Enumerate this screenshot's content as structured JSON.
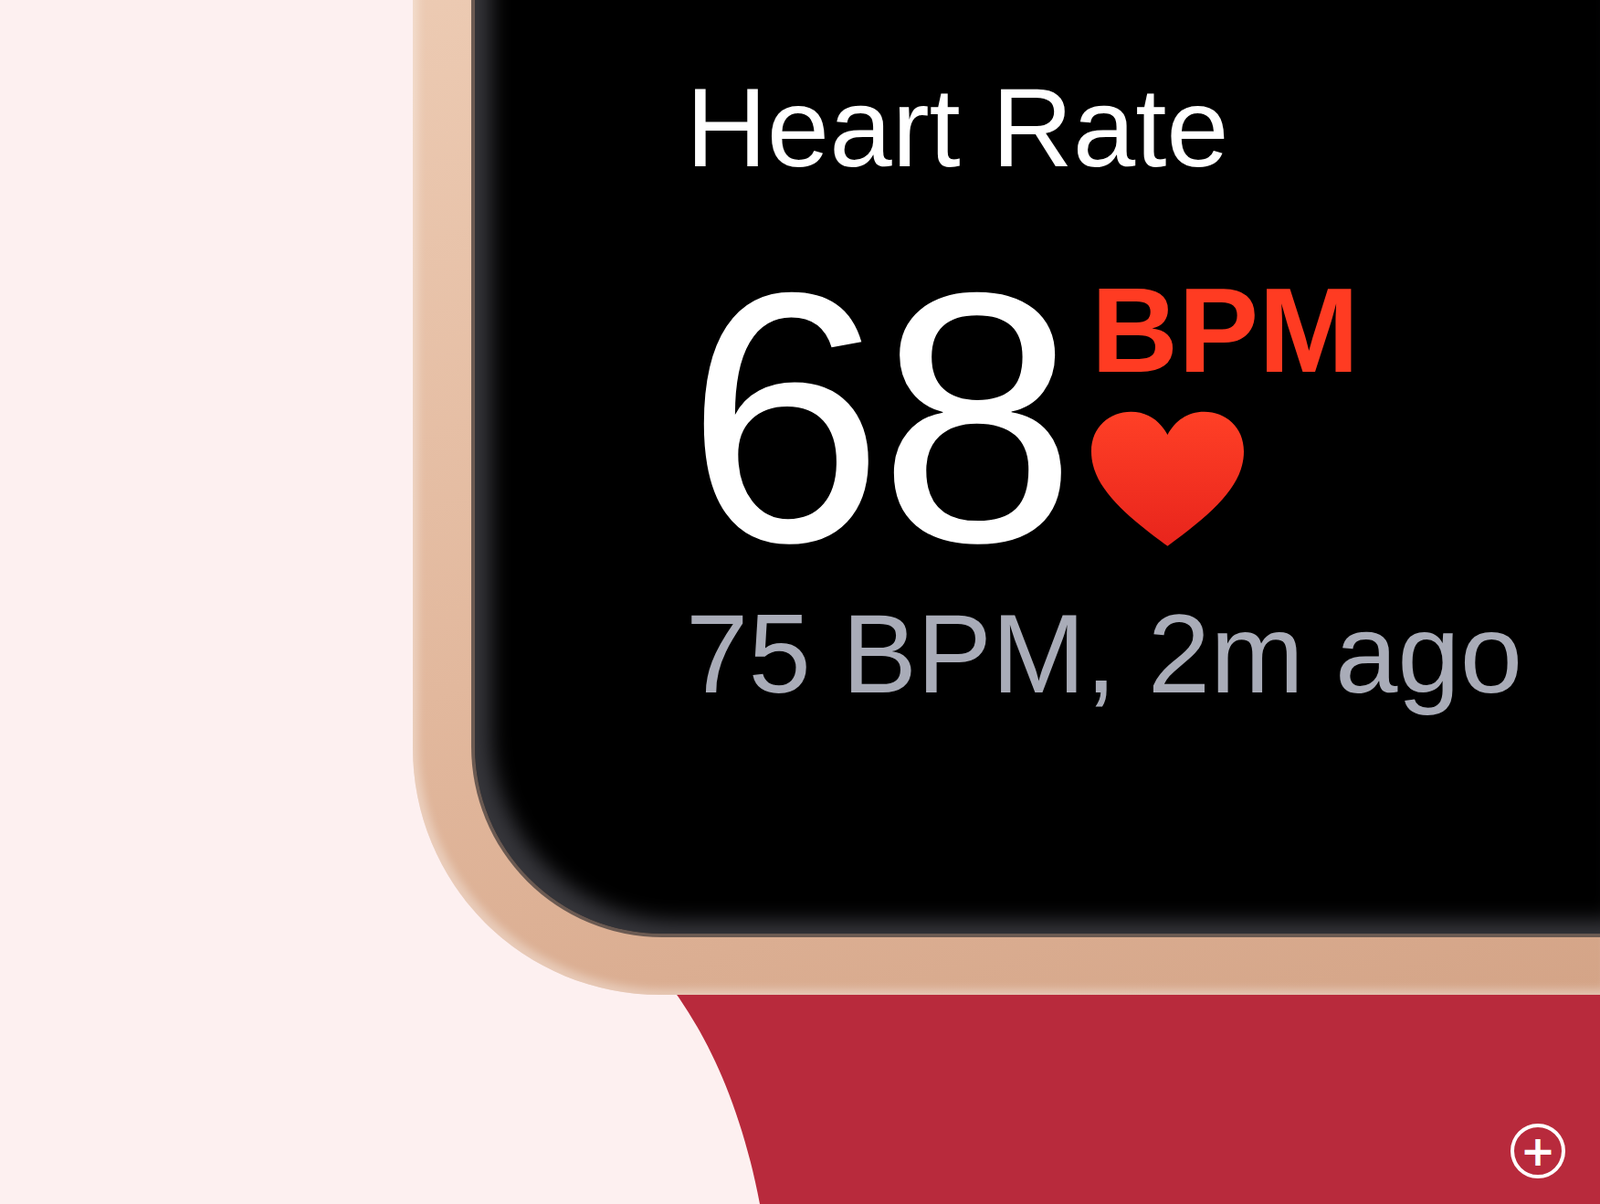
{
  "title": "Heart Rate",
  "current": {
    "value": "68",
    "unit": "BPM"
  },
  "previous": "75 BPM, 2m ago",
  "zoom_button": {
    "label": "+"
  }
}
